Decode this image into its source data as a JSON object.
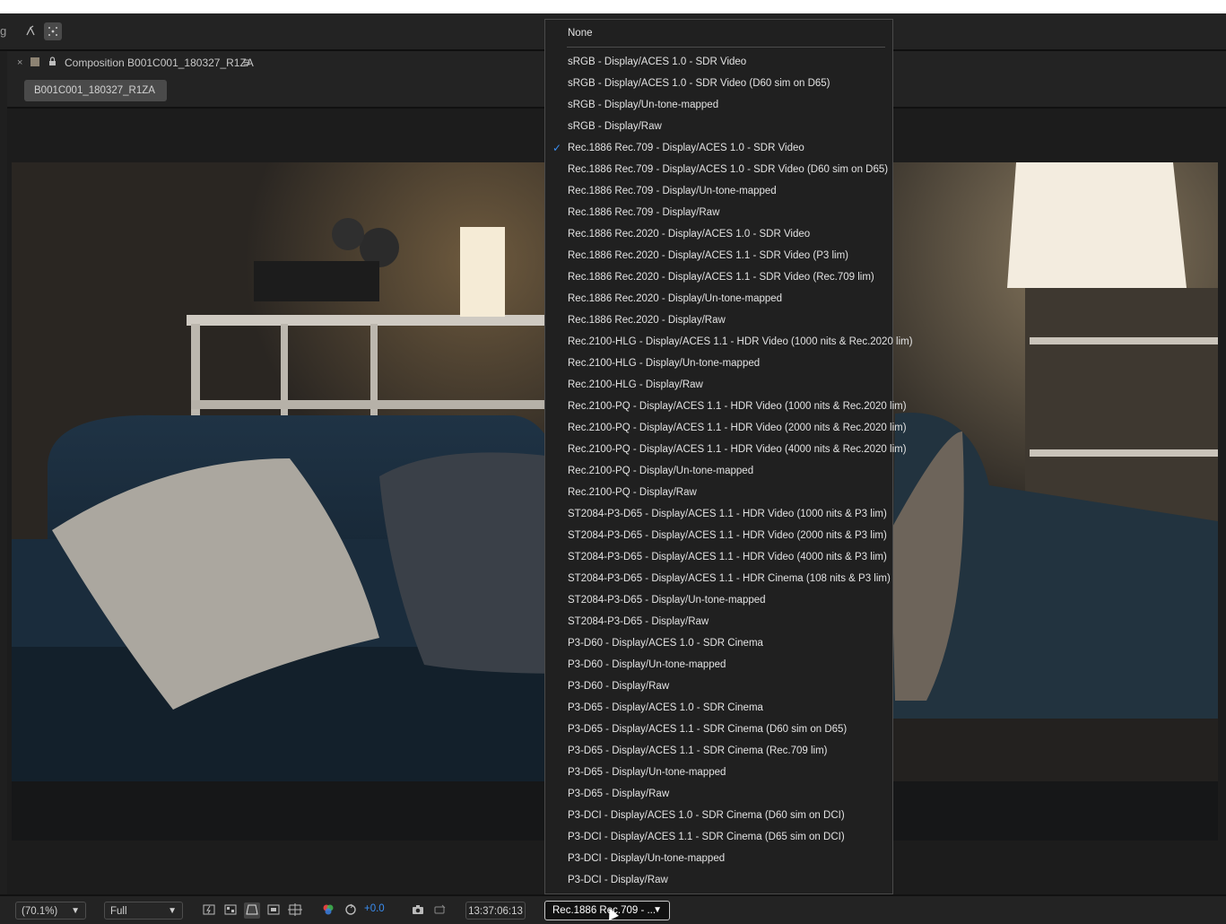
{
  "toolbar": {
    "cut_label": "g"
  },
  "panel": {
    "close_glyph": "×",
    "title": "Composition B001C001_180327_R1ZA",
    "menu_glyph": "≡",
    "tab_label": "B001C001_180327_R1ZA"
  },
  "bottombar": {
    "zoom": "(70.1%)",
    "resolution": "Full",
    "exposure": "+0.0",
    "timecode": "13:37:06:13",
    "view_transform": "Rec.1886 Rec.709 - ..."
  },
  "dropdown": {
    "selected_index": 5,
    "items": [
      "None",
      "sRGB - Display/ACES 1.0 - SDR Video",
      "sRGB - Display/ACES 1.0 - SDR Video (D60 sim on D65)",
      "sRGB - Display/Un-tone-mapped",
      "sRGB - Display/Raw",
      "Rec.1886 Rec.709 - Display/ACES 1.0 - SDR Video",
      "Rec.1886 Rec.709 - Display/ACES 1.0 - SDR Video (D60 sim on D65)",
      "Rec.1886 Rec.709 - Display/Un-tone-mapped",
      "Rec.1886 Rec.709 - Display/Raw",
      "Rec.1886 Rec.2020 - Display/ACES 1.0 - SDR Video",
      "Rec.1886 Rec.2020 - Display/ACES 1.1 - SDR Video (P3 lim)",
      "Rec.1886 Rec.2020 - Display/ACES 1.1 - SDR Video (Rec.709 lim)",
      "Rec.1886 Rec.2020 - Display/Un-tone-mapped",
      "Rec.1886 Rec.2020 - Display/Raw",
      "Rec.2100-HLG - Display/ACES 1.1 - HDR Video (1000 nits & Rec.2020 lim)",
      "Rec.2100-HLG - Display/Un-tone-mapped",
      "Rec.2100-HLG - Display/Raw",
      "Rec.2100-PQ - Display/ACES 1.1 - HDR Video (1000 nits & Rec.2020 lim)",
      "Rec.2100-PQ - Display/ACES 1.1 - HDR Video (2000 nits & Rec.2020 lim)",
      "Rec.2100-PQ - Display/ACES 1.1 - HDR Video (4000 nits & Rec.2020 lim)",
      "Rec.2100-PQ - Display/Un-tone-mapped",
      "Rec.2100-PQ - Display/Raw",
      "ST2084-P3-D65 - Display/ACES 1.1 - HDR Video (1000 nits & P3 lim)",
      "ST2084-P3-D65 - Display/ACES 1.1 - HDR Video (2000 nits & P3 lim)",
      "ST2084-P3-D65 - Display/ACES 1.1 - HDR Video (4000 nits & P3 lim)",
      "ST2084-P3-D65 - Display/ACES 1.1 - HDR Cinema (108 nits & P3 lim)",
      "ST2084-P3-D65 - Display/Un-tone-mapped",
      "ST2084-P3-D65 - Display/Raw",
      "P3-D60 - Display/ACES 1.0 - SDR Cinema",
      "P3-D60 - Display/Un-tone-mapped",
      "P3-D60 - Display/Raw",
      "P3-D65 - Display/ACES 1.0 - SDR Cinema",
      "P3-D65 - Display/ACES 1.1 - SDR Cinema (D60 sim on D65)",
      "P3-D65 - Display/ACES 1.1 - SDR Cinema (Rec.709 lim)",
      "P3-D65 - Display/Un-tone-mapped",
      "P3-D65 - Display/Raw",
      "P3-DCI - Display/ACES 1.0 - SDR Cinema (D60 sim on DCI)",
      "P3-DCI - Display/ACES 1.1 - SDR Cinema (D65 sim on DCI)",
      "P3-DCI - Display/Un-tone-mapped",
      "P3-DCI - Display/Raw"
    ]
  },
  "colors": {
    "accent": "#3a8df0",
    "panel_bg": "#232323",
    "menu_bg": "#202020"
  }
}
